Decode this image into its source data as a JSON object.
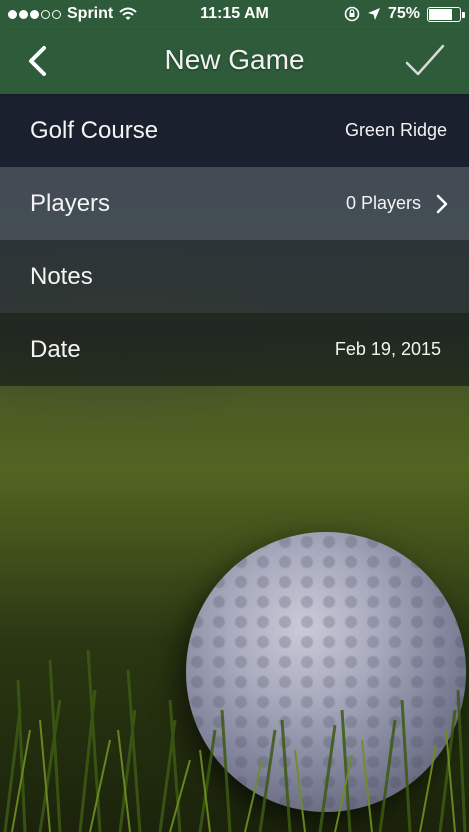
{
  "status_bar": {
    "carrier": "Sprint",
    "time": "11:15 AM",
    "battery": "75%",
    "battery_level": 0.75
  },
  "nav": {
    "title": "New Game"
  },
  "form": {
    "golf_course_label": "Golf Course",
    "golf_course_value": "Green Ridge",
    "players_label": "Players",
    "players_value": "0 Players",
    "notes_label": "Notes",
    "date_label": "Date",
    "date_value": "Feb 19, 2015"
  },
  "colors": {
    "bar_green": "#2e5b3a"
  }
}
